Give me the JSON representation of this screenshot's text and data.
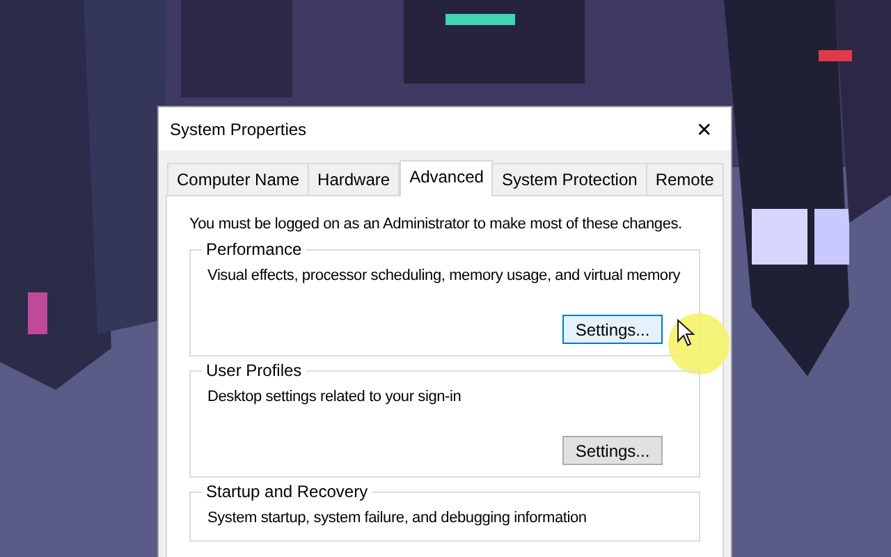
{
  "window": {
    "title": "System Properties",
    "close": "✕"
  },
  "tabs": [
    {
      "label": "Computer Name",
      "selected": false
    },
    {
      "label": "Hardware",
      "selected": false
    },
    {
      "label": "Advanced",
      "selected": true
    },
    {
      "label": "System Protection",
      "selected": false
    },
    {
      "label": "Remote",
      "selected": false
    }
  ],
  "notice": "You must be logged on as an Administrator to make most of these changes.",
  "groups": [
    {
      "title": "Performance",
      "description": "Visual effects, processor scheduling, memory usage, and virtual memory",
      "button": {
        "label": "Settings...",
        "hovered": true
      }
    },
    {
      "title": "User Profiles",
      "description": "Desktop settings related to your sign-in",
      "button": {
        "label": "Settings...",
        "hovered": false
      }
    },
    {
      "title": "Startup and Recovery",
      "description": "System startup, system failure, and debugging information"
    }
  ]
}
